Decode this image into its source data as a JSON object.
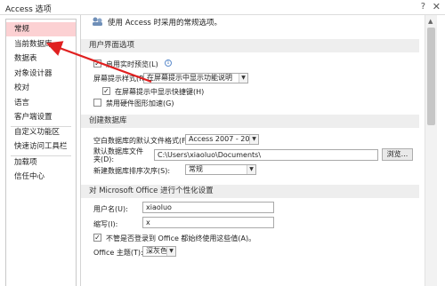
{
  "window": {
    "title": "Access 选项",
    "help_glyph": "?",
    "close_glyph": "✕"
  },
  "sidebar": {
    "items": [
      {
        "label": "常规"
      },
      {
        "label": "当前数据库"
      },
      {
        "label": "数据表"
      },
      {
        "label": "对象设计器"
      },
      {
        "label": "校对"
      },
      {
        "label": "语言"
      },
      {
        "label": "客户端设置"
      },
      {
        "label": "自定义功能区"
      },
      {
        "label": "快速访问工具栏"
      },
      {
        "label": "加载项"
      },
      {
        "label": "信任中心"
      }
    ]
  },
  "main": {
    "top_partial_text": "使用 Access 时采用的常规选项。",
    "ui_section": {
      "title": "用户界面选项",
      "live_preview_label": "启用实时预览(L)",
      "live_preview_checked": true,
      "tooltip_style_label": "屏幕提示样式(R):",
      "tooltip_style_value": "在屏幕提示中显示功能说明",
      "show_shortcuts_label": "在屏幕提示中显示快捷键(H)",
      "show_shortcuts_checked": true,
      "disable_hw_label": "禁用硬件图形加速(G)",
      "disable_hw_checked": false
    },
    "db_section": {
      "title": "创建数据库",
      "file_format_label": "空白数据库的默认文件格式(F):",
      "file_format_value": "Access 2007 - 2013",
      "default_folder_label": "默认数据库文件夹(D):",
      "default_folder_value": "C:\\Users\\xiaoluo\\Documents\\",
      "browse_button": "浏览...",
      "sort_order_label": "新建数据库排序次序(S):",
      "sort_order_value": "常规"
    },
    "personalize_section": {
      "title": "对 Microsoft Office 进行个性化设置",
      "username_label": "用户名(U):",
      "username_value": "xiaoluo",
      "initials_label": "缩写(I):",
      "initials_value": "x",
      "always_use_label": "不管是否登录到 Office 都始终使用这些值(A)。",
      "always_use_checked": true,
      "theme_label": "Office 主题(T):",
      "theme_value": "深灰色"
    }
  },
  "icons": {
    "info": "i",
    "checkmark": "✓",
    "dropdown_arrow": "▼",
    "scroll_up": "▲"
  },
  "colors": {
    "selected_sidebar": "#fcd1d3",
    "annotation_arrow": "#e02020"
  }
}
